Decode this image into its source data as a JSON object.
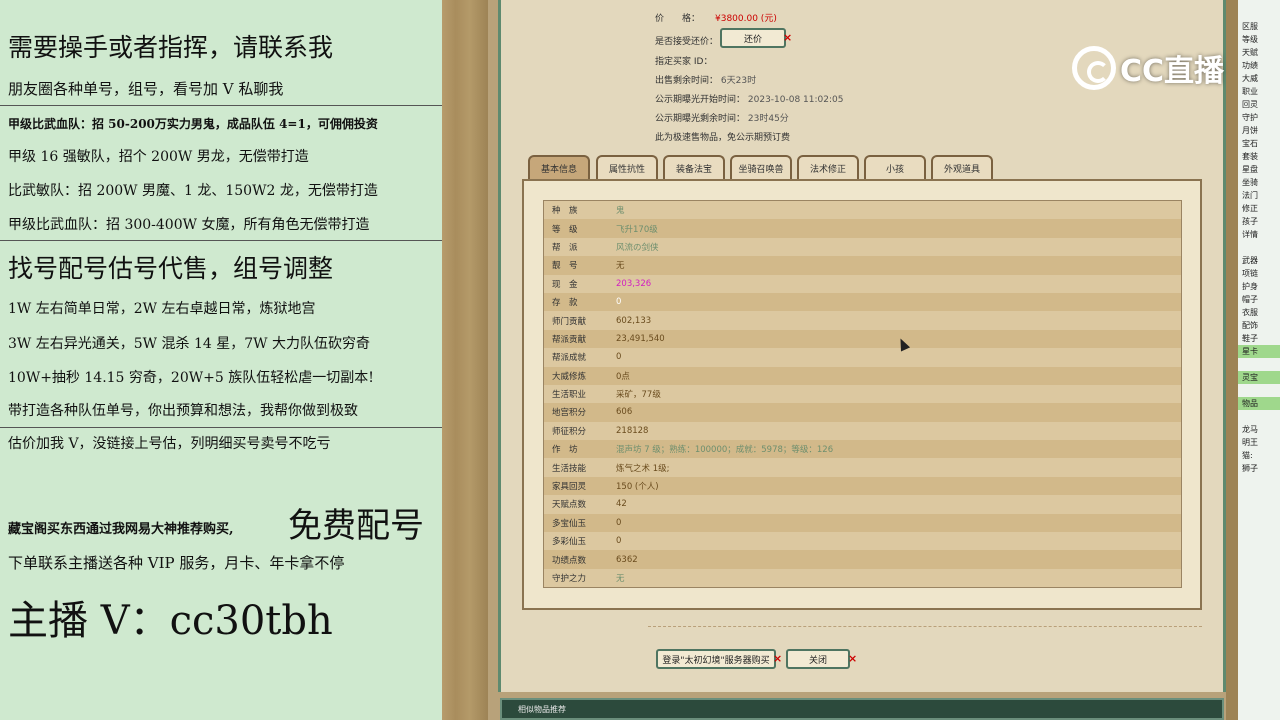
{
  "left": {
    "headline1": "需要操手或者指挥，请联系我",
    "line1": "朋友圈各种单号，组号，看号加 V 私聊我",
    "line2": "甲级比武血队：招 50-200万实力男鬼，成品队伍 4=1，可佣佣投资",
    "line3": "甲级 16 强敏队，招个 200W 男龙，无偿带打造",
    "line4": "比武敏队：招 200W 男魔、1 龙、150W2 龙，无偿带打造",
    "line5": "甲级比武血队：招 300-400W 女魔，所有角色无偿带打造",
    "headline2": "找号配号估号代售，组号调整",
    "line6": "1W 左右简单日常，2W 左右卓越日常，炼狱地宫",
    "line7": "3W 左右异光通关，5W 混杀 14 星，7W 大力队伍砍穷奇",
    "line8": "10W+抽秒 14.15 穷奇，20W+5 族队伍轻松虐一切副本!",
    "line9": "带打造各种队伍单号，你出预算和想法，我帮你做到极致",
    "line10": "估价加我 V，没链接上号估，列明细买号卖号不吃亏",
    "line11a": "藏宝阁买东西通过我网易大神推荐购买,",
    "line11b": "免费配号",
    "line12": "下单联系主播送各种 VIP 服务，月卡、年卡拿不停",
    "contact": "主播 V：cc30tbh"
  },
  "top": {
    "price_label": "价　　格：",
    "price_value": "¥3800.00 (元)",
    "counter_offer_label": "是否接受还价：",
    "counter_offer_btn": "还价",
    "buyer_id_label": "指定买家 ID：",
    "time_left_label": "出售剩余时间：",
    "time_left_value": "6天23时",
    "publicity_start_label": "公示期曝光开始时间：",
    "publicity_start_value": "2023-10-08 11:02:05",
    "publicity_left_label": "公示期曝光剩余时间：",
    "publicity_left_value": "23时45分",
    "note": "此为极速售物品，免公示期预订费"
  },
  "tabs": [
    "基本信息",
    "属性抗性",
    "装备法宝",
    "坐骑召唤兽",
    "法术修正",
    "小孩",
    "外观道具"
  ],
  "info": [
    {
      "label": "种　族",
      "value": "鬼"
    },
    {
      "label": "等　级",
      "value": "飞升170级"
    },
    {
      "label": "帮　派",
      "value": "风流の剑侠"
    },
    {
      "label": "靓　号",
      "value": "无"
    },
    {
      "label": "现　金",
      "value": "203,326"
    },
    {
      "label": "存　款",
      "value": "0"
    },
    {
      "label": "师门贡献",
      "value": "602,133"
    },
    {
      "label": "帮派贡献",
      "value": "23,491,540"
    },
    {
      "label": "帮派成就",
      "value": "0"
    },
    {
      "label": "大威修炼",
      "value": "0点"
    },
    {
      "label": "生活职业",
      "value": "采矿，77级"
    },
    {
      "label": "地宫积分",
      "value": "606"
    },
    {
      "label": "师征积分",
      "value": "218128"
    },
    {
      "label": "作　坊",
      "value": "混声坊 7 级；熟练：100000；成就：5978；等级：126"
    },
    {
      "label": "生活技能",
      "value": "炼气之术 1级;"
    },
    {
      "label": "家具回灵",
      "value": "150 (个人)"
    },
    {
      "label": "天赋点数",
      "value": "42"
    },
    {
      "label": "多宝仙玉",
      "value": "0"
    },
    {
      "label": "多彩仙玉",
      "value": "0"
    },
    {
      "label": "功绩点数",
      "value": "6362"
    },
    {
      "label": "守护之力",
      "value": "无"
    }
  ],
  "buttons": {
    "login": "登录\"太初幻境\"服务器购买",
    "close": "关闭"
  },
  "bottom_bar": "相似物品推荐",
  "logo_text": "CC直播",
  "right_items": [
    "区服",
    "等级",
    "天赋",
    "功绩",
    "大威",
    "职业",
    "回灵",
    "守护",
    "月饼",
    "宝石",
    "套装",
    "星盘",
    "坐骑",
    "法门",
    "修正",
    "孩子",
    "详情",
    "",
    "武器",
    "项链",
    "护身",
    "帽子",
    "衣服",
    "配饰",
    "鞋子",
    "星卡",
    "",
    "灵宝",
    "",
    "物品",
    "",
    "龙马",
    "明王",
    "猫:",
    "狮子"
  ]
}
